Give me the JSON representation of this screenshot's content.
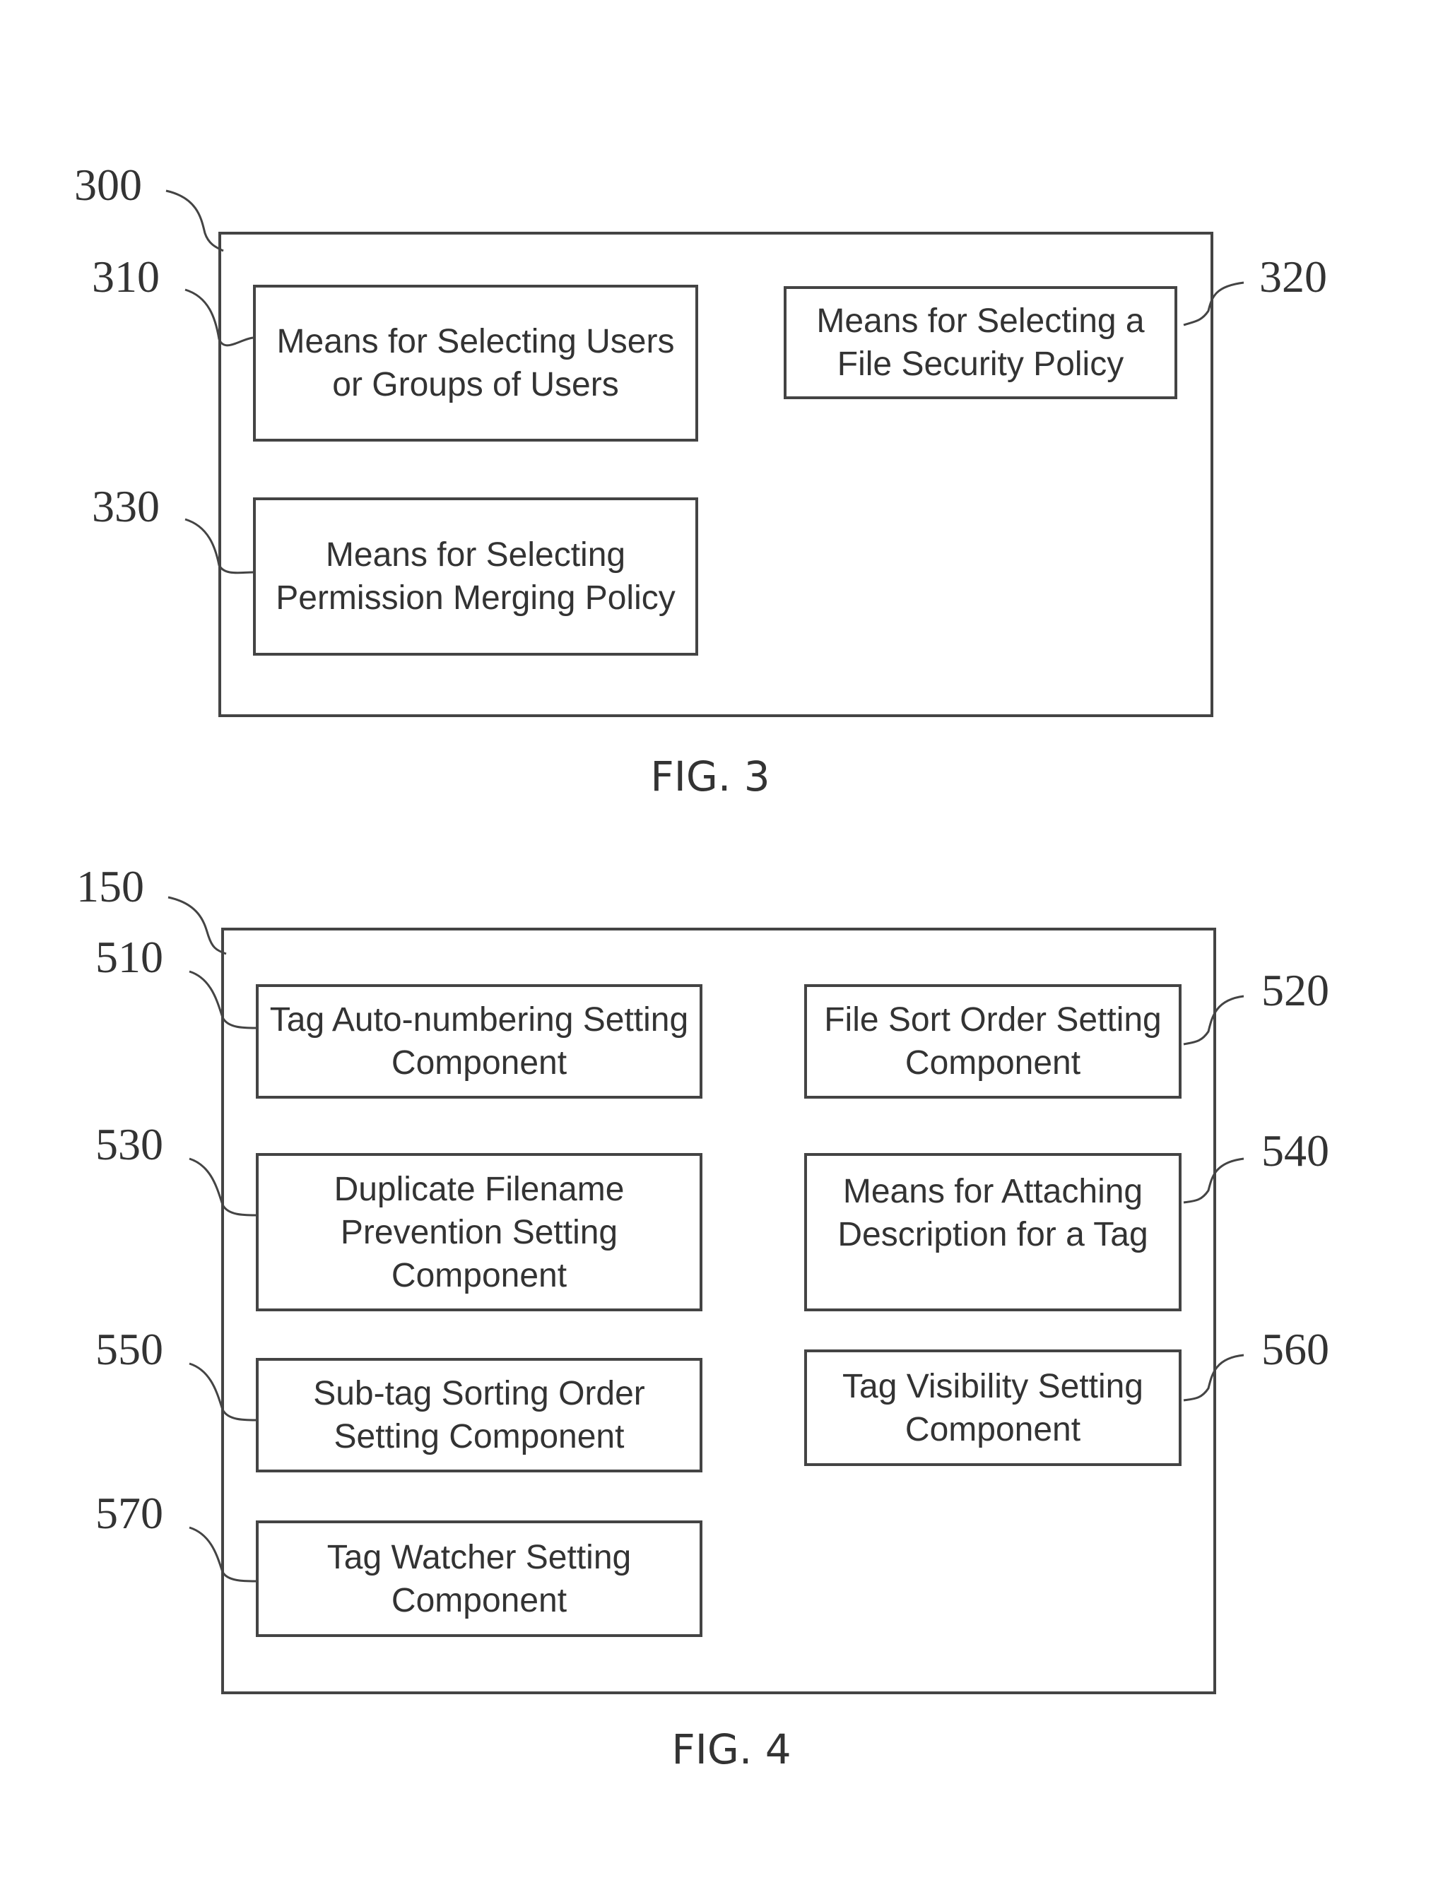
{
  "figures": [
    {
      "caption": "FIG. 3",
      "ref": "300",
      "components": [
        {
          "ref": "310",
          "label": "Means for Selecting Users or Groups of Users"
        },
        {
          "ref": "320",
          "label": "Means for Selecting a File Security Policy"
        },
        {
          "ref": "330",
          "label": "Means for Selecting Permission Merging Policy"
        }
      ]
    },
    {
      "caption": "FIG. 4",
      "ref": "150",
      "components": [
        {
          "ref": "510",
          "label": "Tag Auto-numbering Setting Component"
        },
        {
          "ref": "520",
          "label": "File Sort Order Setting Component"
        },
        {
          "ref": "530",
          "label": "Duplicate Filename Prevention Setting Component"
        },
        {
          "ref": "540",
          "label": "Means for Attaching Description for a Tag"
        },
        {
          "ref": "550",
          "label": "Sub-tag Sorting Order Setting Component"
        },
        {
          "ref": "560",
          "label": "Tag Visibility Setting Component"
        },
        {
          "ref": "570",
          "label": "Tag Watcher Setting Component"
        }
      ]
    }
  ]
}
